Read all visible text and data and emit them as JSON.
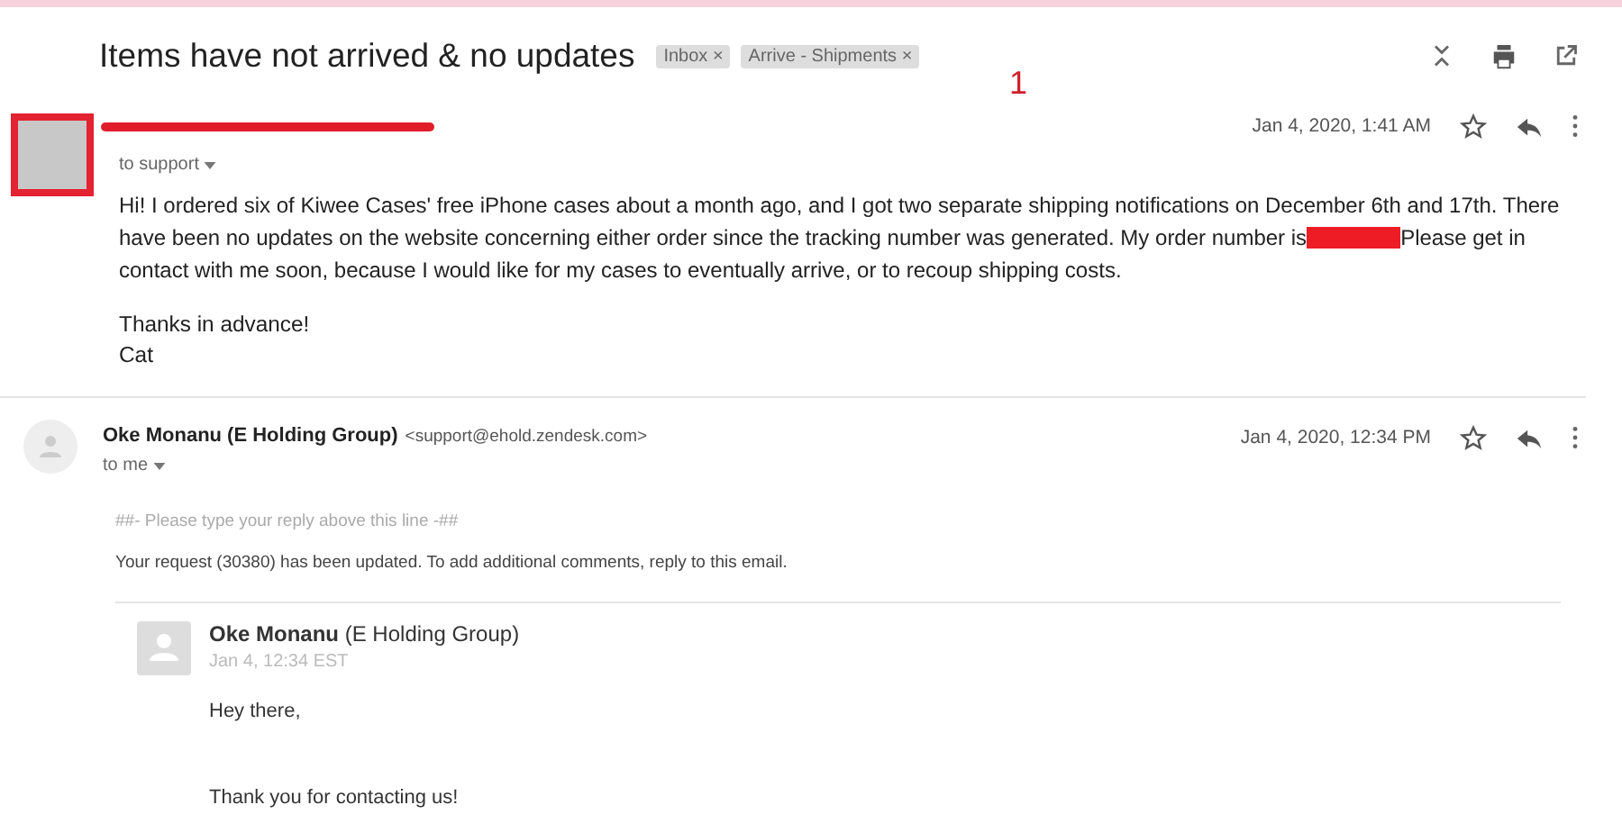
{
  "subject": "Items have not arrived & no updates",
  "labels": [
    {
      "text": "Inbox",
      "close": "×"
    },
    {
      "text": "Arrive - Shipments",
      "close": "×"
    }
  ],
  "annotation": "1",
  "messages": [
    {
      "kind": "customer",
      "recipient": "to support",
      "date": "Jan 4, 2020, 1:41 AM",
      "starred": false,
      "body_lines": [
        {
          "text": "Hi! I ordered six of Kiwee Cases' free iPhone cases about a month ago, and I got two separate shipping notifications on December 6th and 17th. There",
          "redacted": false
        },
        {
          "text": "have been no updates on the website concerning either order since the tracking number was generated. My order number is",
          "redacted": true,
          "after": "Please get in"
        },
        {
          "text": "contact with me soon, because I would like for my cases to eventually arrive, or to recoup shipping costs.",
          "redacted": false
        }
      ],
      "closing": "Thanks in advance!",
      "signature": "Cat"
    },
    {
      "kind": "support",
      "sender": "Oke Monanu (E Holding Group)",
      "email": "<support@ehold.zendesk.com>",
      "recipient": "to me",
      "date": "Jan 4, 2020, 12:34 PM",
      "starred": false,
      "reply_line": "##- Please type your reply above this line -##",
      "update_note": "Your request (30380) has been updated. To add additional comments, reply to this email.",
      "quoted": {
        "name": "Oke Monanu",
        "org": "(E Holding Group)",
        "time": "Jan 4, 12:34 EST",
        "greeting": "Hey there,",
        "text": "Thank you for contacting us!"
      }
    }
  ]
}
